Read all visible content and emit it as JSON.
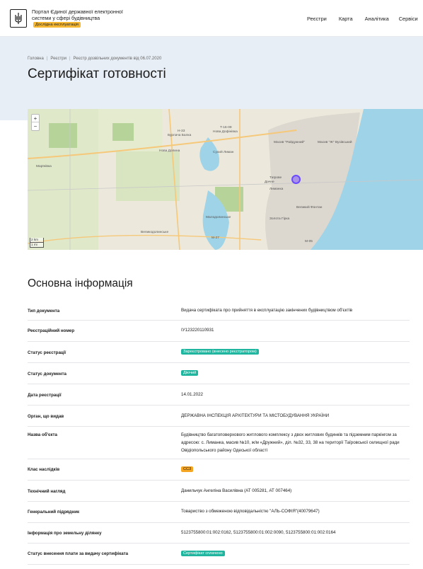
{
  "header": {
    "portal_title": "Портал Єдиної державної електронної системи у сфері будівництва",
    "beta_badge": "Дослідна експлуатація",
    "nav": [
      "Реєстри",
      "Карта",
      "Аналітика",
      "Сервіси"
    ]
  },
  "breadcrumb": [
    "Головна",
    "Реєстри",
    "Реєстр дозвільних документів від 06.07.2020"
  ],
  "page_title": "Сертифікат готовності",
  "map": {
    "zoom_in": "+",
    "zoom_out": "−",
    "scale_km": "2 km",
    "scale_mi": "1 mi",
    "labels": [
      "Нова Долина",
      "Сухий Лиман",
      "Нова Дофінівка",
      "Масив \"Райдужний\"",
      "Масив \"Ж\" Вузівський",
      "Великий Фонтан",
      "Лиманка",
      "Дачне",
      "Малодолинське",
      "Великодолинське",
      "Золота Гірка",
      "Марїнівка",
      "Бурлача Балка",
      "Таїрове"
    ],
    "road_labels": [
      "H-33",
      "T-16-09",
      "M-27",
      "M-05"
    ]
  },
  "section": {
    "title": "Основна інформація",
    "rows": [
      {
        "label": "Тип документа",
        "value": "Видача сертифіката про прийняття в експлуатацію закінчених будівництвом об'єктів"
      },
      {
        "label": "Реєстраційний номер",
        "value": "ІУ123220110931"
      },
      {
        "label": "Статус реєстрації",
        "value": "Зареєстровано (внесено реєстратором)"
      },
      {
        "label": "Статус документа",
        "value": "Діючий"
      },
      {
        "label": "Дата реєстрації",
        "value": "14.01.2022"
      },
      {
        "label": "Орган, що видав",
        "value": "ДЕРЖАВНА ІНСПЕКЦІЯ АРХІТЕКТУРИ ТА МІСТОБУДУВАННЯ УКРАЇНИ"
      },
      {
        "label": "Назва об'єкта",
        "value": "Будівництво багатоповерхового житлового комплексу з двох житлових будинків та підземним паркінгом за адресою: с. Лиманка, масив №10, ж/м «Дружний», діл. №32, 33, 38 на території Таїровської селищної ради Овідіопольського району Одеської області"
      },
      {
        "label": "Клас наслідків",
        "value": "СС3"
      },
      {
        "label": "Технічний нагляд",
        "value": "Данильчук Ангеліна Василівна (АТ 005281, АТ 007464)"
      },
      {
        "label": "Генеральний підрядник",
        "value": "Товариство з обмеженою відповідальністю \"АЛЬ-СОФІЯ\"(40079647)"
      },
      {
        "label": "Інформація про земельну ділянку",
        "value": "5123755800:01:002:0162, 5123755800:01:002:0090, 5123755800:01:002:0164"
      },
      {
        "label": "Статус внесення плати за видачу сертифіката",
        "value": "Сертифікат сплачено"
      }
    ]
  },
  "colors": {
    "accent_green": "#1fb59e",
    "accent_orange": "#f5a623",
    "hero_bg": "#e8eef5",
    "sea": "#9ed3e8"
  }
}
